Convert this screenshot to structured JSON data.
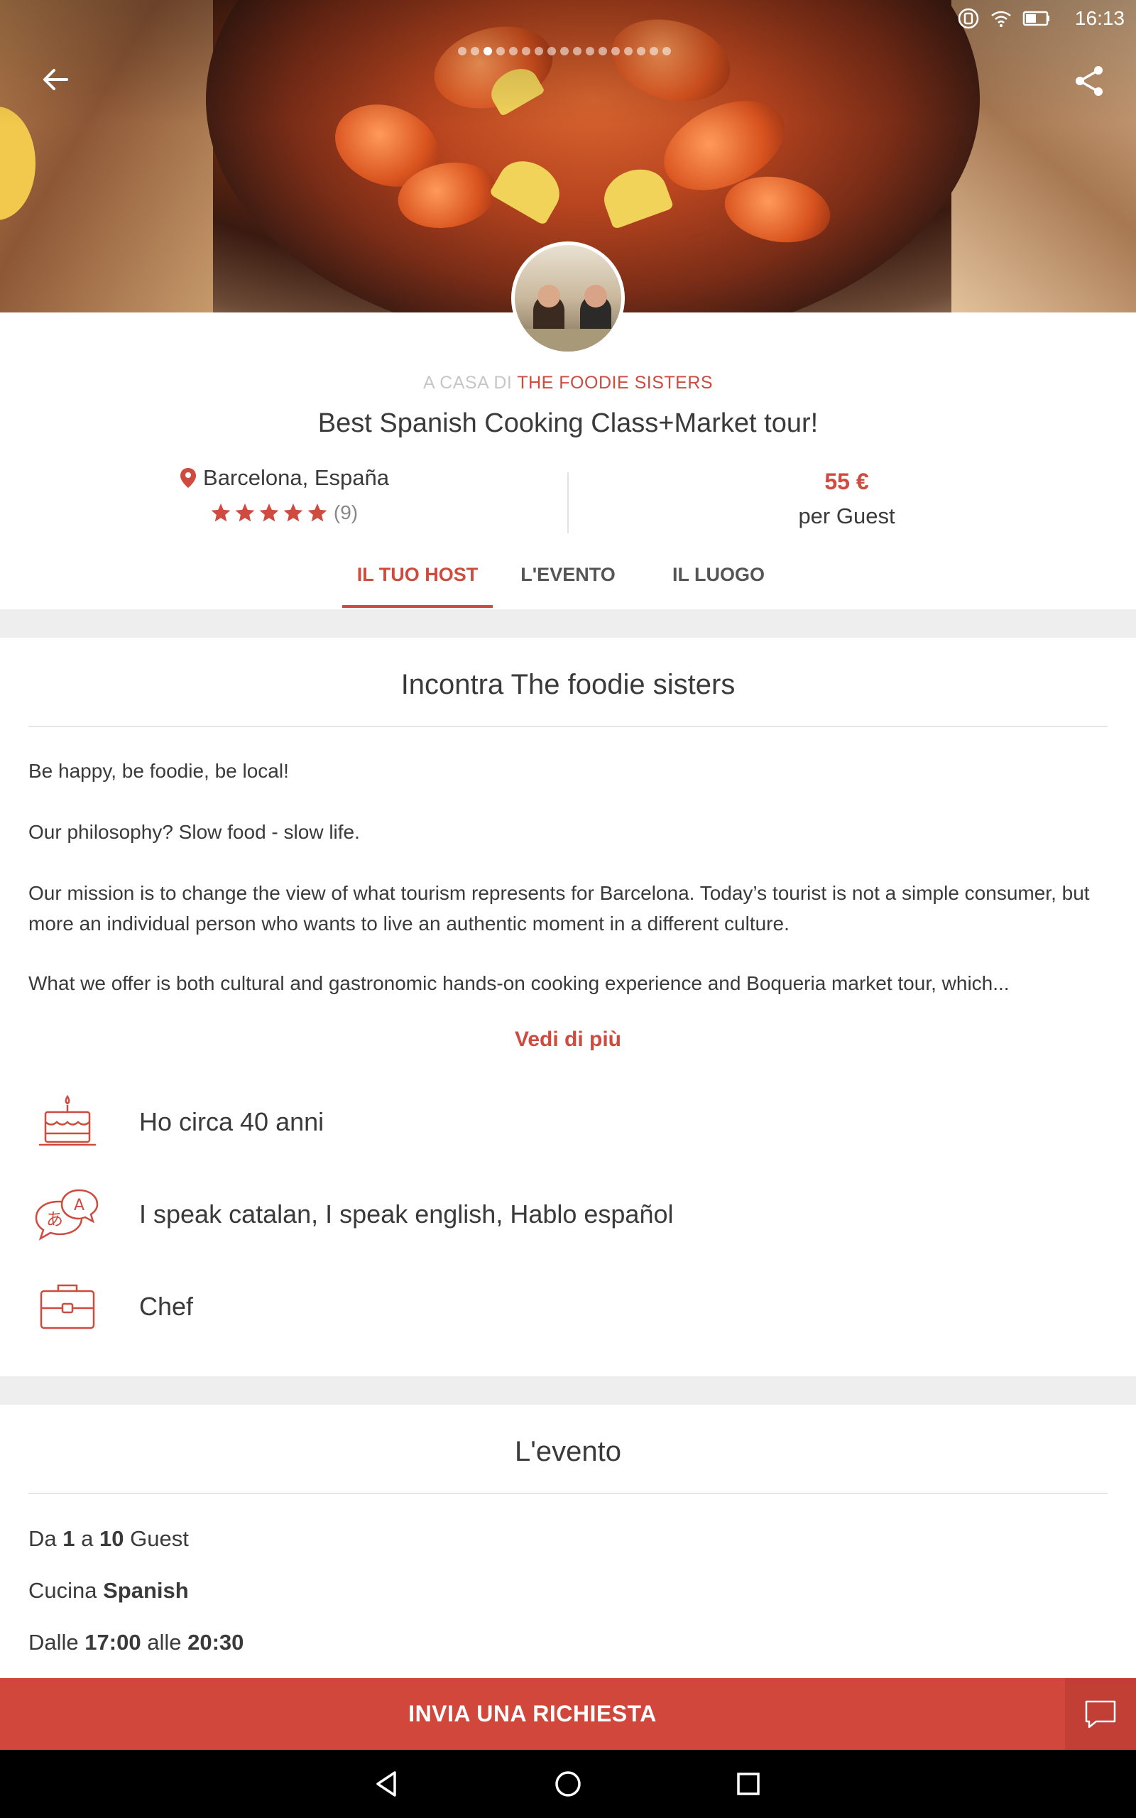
{
  "status_bar": {
    "time": "16:13"
  },
  "hero": {
    "carousel": {
      "total_pages": 17,
      "active_index": 2
    }
  },
  "host_line": {
    "prefix": "A CASA DI",
    "name": "THE FOODIE SISTERS"
  },
  "title": "Best Spanish Cooking Class+Market tour!",
  "location": "Barcelona, España",
  "rating": {
    "stars": 5,
    "count_label": "(9)"
  },
  "price": {
    "amount": "55 €",
    "unit": "per Guest"
  },
  "tabs": [
    {
      "label": "IL TUO HOST",
      "active": true
    },
    {
      "label": "L'EVENTO",
      "active": false
    },
    {
      "label": "IL LUOGO",
      "active": false
    }
  ],
  "host_section": {
    "title": "Incontra The foodie sisters",
    "paragraphs": [
      "Be happy, be foodie, be local!",
      "Our philosophy? Slow food - slow life.",
      "Our mission is to change the view of what tourism represents for Barcelona. Today’s tourist is not a simple consumer, but more an individual person who wants to live an authentic moment in a different culture.",
      "What we offer is both cultural and gastronomic hands-on cooking experience and Boqueria market tour, which..."
    ],
    "see_more": "Vedi di più",
    "facts": [
      {
        "icon": "birthday-cake-icon",
        "text": "Ho circa 40 anni"
      },
      {
        "icon": "languages-icon",
        "text": "I speak catalan, I speak english, Hablo español"
      },
      {
        "icon": "briefcase-icon",
        "text": "Chef"
      }
    ]
  },
  "event_section": {
    "title": "L'evento",
    "guests": {
      "prefix": "Da",
      "min": "1",
      "mid": "a",
      "max": "10",
      "suffix": "Guest"
    },
    "cuisine": {
      "prefix": "Cucina",
      "value": "Spanish"
    },
    "hours": {
      "prefix": "Dalle",
      "start": "17:00",
      "mid": "alle",
      "end": "20:30"
    }
  },
  "cta": {
    "label": "INVIA UNA RICHIESTA"
  },
  "colors": {
    "accent": "#cf4b3f",
    "cta": "#d2473b",
    "band": "#eeeeee"
  }
}
